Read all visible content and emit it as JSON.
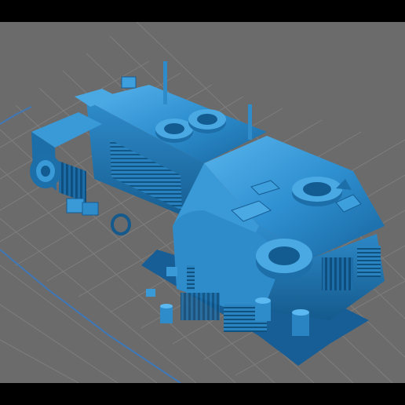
{
  "viewer": {
    "background_color": "#6b6b6b",
    "grid_color": "#7b7b7b",
    "plate_edge_color": "#3e78b8",
    "model_color": "#2d8fd0",
    "model_shadow_color": "#0f5f9a",
    "model_highlight_color": "#5cb8f0",
    "frame_color": "#000000"
  },
  "scene": {
    "object": "3d-model-armored-truck",
    "icons": [
      "tire-icon",
      "barrel-icon",
      "crate-icon",
      "ladder-icon",
      "exhaust-pipe-icon"
    ]
  }
}
